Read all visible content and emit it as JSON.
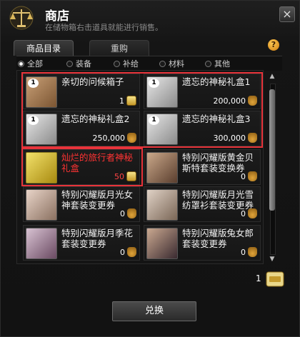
{
  "window": {
    "title": "商店",
    "subtitle": "在储物箱右击道具就能进行销售。",
    "close_label": "×",
    "help_label": "?"
  },
  "tabs": [
    {
      "label": "商品目录",
      "active": true
    },
    {
      "label": "重购",
      "active": false
    }
  ],
  "filters": [
    {
      "label": "全部",
      "checked": true
    },
    {
      "label": "装备",
      "checked": false
    },
    {
      "label": "补给",
      "checked": false
    },
    {
      "label": "材料",
      "checked": false
    },
    {
      "label": "其他",
      "checked": false
    }
  ],
  "items": [
    {
      "name": "亲切的问候箱子",
      "price": "1",
      "currency": "ticket",
      "badge": "1",
      "icon": "box-icon",
      "highlight": false
    },
    {
      "name": "遗忘的神秘礼盒1",
      "price": "200,000",
      "currency": "gold",
      "badge": "1",
      "icon": "lv1-box-icon",
      "highlight": false
    },
    {
      "name": "遗忘的神秘礼盒2",
      "price": "250,000",
      "currency": "gold",
      "badge": "1",
      "icon": "lv2-box-icon",
      "highlight": false
    },
    {
      "name": "遗忘的神秘礼盒3",
      "price": "300,000",
      "currency": "gold",
      "badge": "1",
      "icon": "lv3-box-icon",
      "highlight": false
    },
    {
      "name": "灿烂的旅行者神秘礼盒",
      "price": "50",
      "currency": "ticket",
      "badge": "",
      "icon": "golden-box-icon",
      "highlight": true
    },
    {
      "name": "特别闪耀版黄金贝斯特套装变换券",
      "price": "0",
      "currency": "gold",
      "badge": "",
      "icon": "costume-icon",
      "highlight": false
    },
    {
      "name": "特别闪耀版月光女神套装变更券",
      "price": "0",
      "currency": "gold",
      "badge": "",
      "icon": "costume-icon",
      "highlight": false
    },
    {
      "name": "特别闪耀版月光雪纺罩衫套装变更券",
      "price": "0",
      "currency": "gold",
      "badge": "",
      "icon": "costume-icon",
      "highlight": false
    },
    {
      "name": "特别闪耀版月季花套装变更券",
      "price": "0",
      "currency": "gold",
      "badge": "",
      "icon": "costume-icon",
      "highlight": false
    },
    {
      "name": "特别闪耀版兔女郎套装变更券",
      "price": "0",
      "currency": "gold",
      "badge": "",
      "icon": "costume-icon",
      "highlight": false
    }
  ],
  "footer": {
    "ticket_count": "1",
    "exchange_label": "兑换"
  },
  "colors": {
    "highlight_frame": "#e8333a",
    "price_red": "#ff4444"
  }
}
